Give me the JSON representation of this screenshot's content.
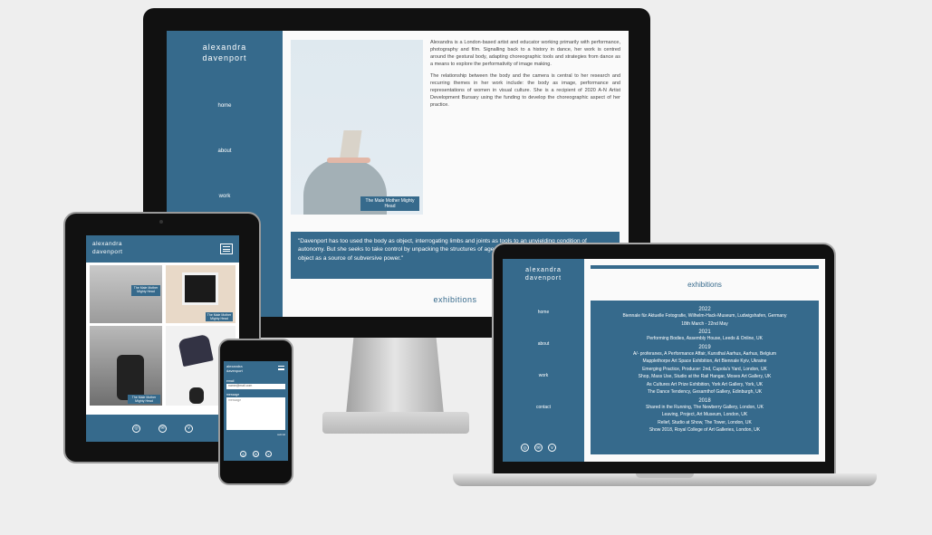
{
  "site": {
    "logo_line1": "alexandra",
    "logo_line2": "davenport",
    "nav": [
      "home",
      "about",
      "work",
      "contact"
    ]
  },
  "desktop": {
    "bio_p1": "Alexandra is a London-based artist and educator working primarily with performance, photography and film. Signalling back to a history in dance, her work is centred around the gestural body, adapting choreographic tools and strategies from dance as a means to explore the performativity of image making.",
    "bio_p2": "The relationship between the body and the camera is central to her research and recurring themes in her work include: the body as image, performance and representations of women in visual culture. She is a recipient of 2020 A-N Artist Development Bursary using the funding to develop the choreographic aspect of her practice.",
    "photo_caption": "The Male Mother Mighty Head",
    "quote": "\"Davenport has too used the body as object, interrogating limbs and joints as tools to an unyielding condition of autonomy. But she seeks to take control by unpacking the structures of agency as producers, reclaiming the body as object as a source of subversive power.\"",
    "section_heading": "exhibitions"
  },
  "laptop": {
    "heading": "exhibitions",
    "years": [
      {
        "year": "2022",
        "lines": [
          "Biennale für Aktuelle Fotografie, Wilhelm-Hack-Museum, Ludwigshafen, Germany",
          "18th March - 22nd May"
        ]
      },
      {
        "year": "2021",
        "lines": [
          "Performing Bodies, Assembly House, Leeds & Online, UK"
        ]
      },
      {
        "year": "2019",
        "lines": [
          "A/- proferanes, A Performance Affair, Kunsthal Aarhus, Aarhus, Belgium",
          "Mapplethorpe Art Space Exhibition, Art Biennale Kyiv, Ukraine",
          "Emerging Practice, Producer: 2nd, Cupola's Yard, London, UK",
          "Shop, Mass Use, Studio at the Rail Hangar, Moses Art Gallery, UK",
          "As Cultures Art Prize Exhibition, York Art Gallery, York, UK",
          "The Dance Tendency, Gesamthof Gallery, Edinburgh, UK"
        ]
      },
      {
        "year": "2018",
        "lines": [
          "Shared in the Running, The Newberry Gallery, London, UK",
          "Leaving, Project, Art Museum, London, UK",
          "Relief, Studio at Show, The Tower, London, UK",
          "Show 2018, Royal College of Art Galleries, London, UK"
        ]
      }
    ]
  },
  "tablet": {
    "caption1": "The Male Mother Mighty Head",
    "caption2": "The Male Mother Mighty Head",
    "caption3": "The Male Mother Mighty Head"
  },
  "phone": {
    "label_email": "email",
    "email_value": "name@mail.com",
    "label_message": "message",
    "message_placeholder": "message",
    "submit": "submit"
  },
  "icons": [
    "instagram-icon",
    "mail-icon",
    "vimeo-icon"
  ],
  "colors": {
    "teal": "#366a8c",
    "bezel": "#0d0d0d",
    "background": "#eeeeee"
  }
}
